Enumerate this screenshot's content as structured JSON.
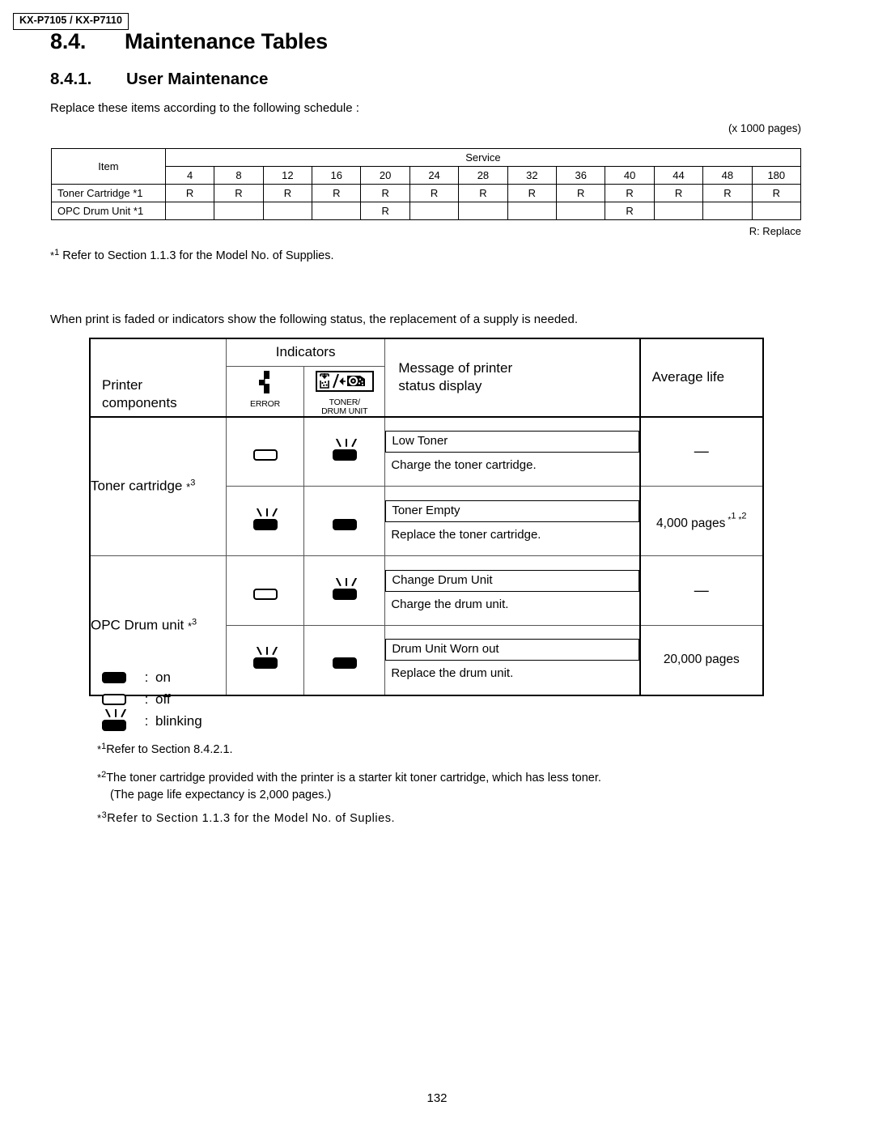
{
  "header": {
    "model_left": "KX-P7105",
    "model_sep": "/",
    "model_right": "KX-P7110"
  },
  "section": {
    "number": "8.4.",
    "title": "Maintenance Tables",
    "sub_number": "8.4.1.",
    "sub_title": "User Maintenance"
  },
  "intro": {
    "schedule_line": "Replace these items according to the following schedule :",
    "unit_note": "(x 1000 pages)",
    "replace_legend": "R: Replace",
    "note_star1_mark_star": "*",
    "note_star1_mark_digit": "1",
    "note_star1_text": "Refer to Section 1.1.3 for the Model No. of Supplies.",
    "indicator_line": "When print is faded or indicators show the following status, the replacement of a supply is needed."
  },
  "schedule_table": {
    "item_header": "Item",
    "service_header": "Service",
    "columns": [
      "4",
      "8",
      "12",
      "16",
      "20",
      "24",
      "28",
      "32",
      "36",
      "40",
      "44",
      "48",
      "180"
    ],
    "rows": [
      {
        "label": "Toner Cartridge *1",
        "values": [
          "R",
          "R",
          "R",
          "R",
          "R",
          "R",
          "R",
          "R",
          "R",
          "R",
          "R",
          "R",
          "R"
        ]
      },
      {
        "label": "OPC Drum Unit *1",
        "values": [
          "",
          "",
          "",
          "",
          "R",
          "",
          "",
          "",
          "",
          "R",
          "",
          "",
          ""
        ]
      }
    ]
  },
  "indicators_table": {
    "headers": {
      "printer_components_line1": "Printer",
      "printer_components_line2": "components",
      "indicators": "Indicators",
      "error_caption": "ERROR",
      "toner_caption_line1": "TONER/",
      "toner_caption_line2": "DRUM UNIT",
      "message_line1": "Message of printer",
      "message_line2": "status display",
      "average_life": "Average life"
    },
    "rows": [
      {
        "component": "Toner cartridge",
        "component_sup": "3",
        "error_state": "off",
        "toner_state": "blinking",
        "message": "Low Toner",
        "action": "Charge the toner cartridge.",
        "life": "—",
        "life_sup": ""
      },
      {
        "component": "",
        "component_sup": "",
        "error_state": "blinking",
        "toner_state": "on",
        "message": "Toner Empty",
        "action": "Replace the toner cartridge.",
        "life": "4,000 pages",
        "life_sup": "*1 *2"
      },
      {
        "component": "OPC Drum unit",
        "component_sup": "3",
        "error_state": "off",
        "toner_state": "blinking",
        "message": "Change Drum Unit",
        "action": "Charge the drum unit.",
        "life": "—",
        "life_sup": ""
      },
      {
        "component": "",
        "component_sup": "",
        "error_state": "blinking",
        "toner_state": "on",
        "message": "Drum Unit Worn out",
        "action": "Replace the drum unit.",
        "life": "20,000 pages",
        "life_sup": ""
      }
    ]
  },
  "legend": {
    "colon": ":",
    "on_label": "on",
    "off_label": "off",
    "blinking_label": "blinking"
  },
  "footnotes": {
    "fn1_star": "*",
    "fn1_digit": "1",
    "fn1_text": "Refer to Section 8.4.2.1.",
    "fn2_star": "*",
    "fn2_digit": "2",
    "fn2_text": "The toner cartridge provided with the printer is a starter kit toner cartridge, which has less toner.",
    "fn2_cont": "(The page life expectancy is 2,000 pages.)",
    "fn3_star": "*",
    "fn3_digit": "3",
    "fn3_text": "Refer to Section 1.1.3 for the Model No. of Suplies."
  },
  "page_number": "132",
  "colors": {
    "ink": "#000000",
    "rule": "#555555",
    "paper": "#ffffff"
  }
}
